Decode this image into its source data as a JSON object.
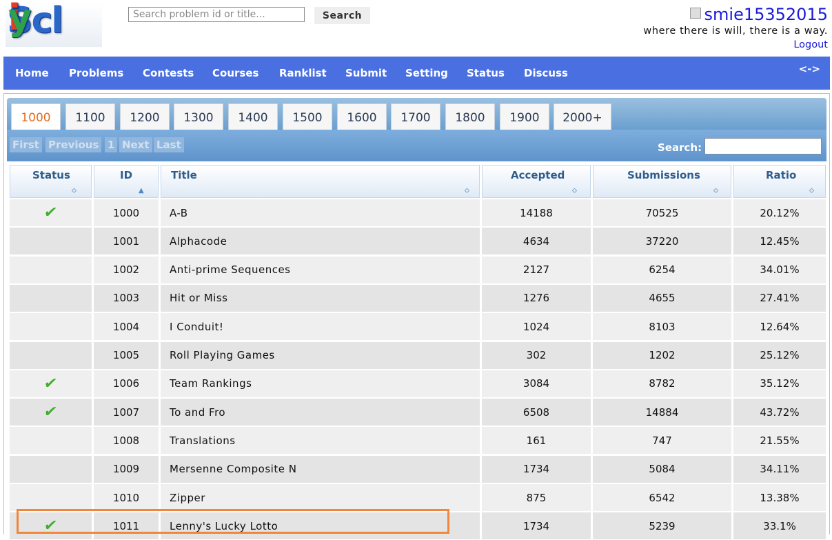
{
  "header": {
    "logo_text": "Sicily",
    "search": {
      "placeholder": "Search problem id or title...",
      "value": "",
      "button_label": "Search"
    },
    "user": {
      "name": "smie15352015",
      "motto": "where there is will,  there is a way.",
      "logout_label": "Logout"
    }
  },
  "navbar": {
    "items": [
      "Home",
      "Problems",
      "Contests",
      "Courses",
      "Ranklist",
      "Submit",
      "Setting",
      "Status",
      "Discuss"
    ],
    "toggle_label": "<->"
  },
  "volume_tabs": {
    "items": [
      "1000",
      "1100",
      "1200",
      "1300",
      "1400",
      "1500",
      "1600",
      "1700",
      "1800",
      "1900",
      "2000+"
    ],
    "active": "1000"
  },
  "pager": {
    "first": "First",
    "previous": "Previous",
    "page": "1",
    "next": "Next",
    "last": "Last",
    "search_label": "Search:",
    "search_value": ""
  },
  "table": {
    "columns": [
      "Status",
      "ID",
      "Title",
      "Accepted",
      "Submissions",
      "Ratio"
    ],
    "sort_column": "ID",
    "rows": [
      {
        "solved": true,
        "status": "✔",
        "id": "1000",
        "title": "A-B",
        "accepted": "14188",
        "submissions": "70525",
        "ratio": "20.12%"
      },
      {
        "solved": false,
        "status": "",
        "id": "1001",
        "title": "Alphacode",
        "accepted": "4634",
        "submissions": "37220",
        "ratio": "12.45%"
      },
      {
        "solved": false,
        "status": "",
        "id": "1002",
        "title": "Anti-prime Sequences",
        "accepted": "2127",
        "submissions": "6254",
        "ratio": "34.01%"
      },
      {
        "solved": false,
        "status": "",
        "id": "1003",
        "title": "Hit or Miss",
        "accepted": "1276",
        "submissions": "4655",
        "ratio": "27.41%"
      },
      {
        "solved": false,
        "status": "",
        "id": "1004",
        "title": "I Conduit!",
        "accepted": "1024",
        "submissions": "8103",
        "ratio": "12.64%"
      },
      {
        "solved": false,
        "status": "",
        "id": "1005",
        "title": "Roll Playing Games",
        "accepted": "302",
        "submissions": "1202",
        "ratio": "25.12%"
      },
      {
        "solved": true,
        "status": "✔",
        "id": "1006",
        "title": "Team Rankings",
        "accepted": "3084",
        "submissions": "8782",
        "ratio": "35.12%"
      },
      {
        "solved": true,
        "status": "✔",
        "id": "1007",
        "title": "To and Fro",
        "accepted": "6508",
        "submissions": "14884",
        "ratio": "43.72%"
      },
      {
        "solved": false,
        "status": "",
        "id": "1008",
        "title": "Translations",
        "accepted": "161",
        "submissions": "747",
        "ratio": "21.55%"
      },
      {
        "solved": false,
        "status": "",
        "id": "1009",
        "title": "Mersenne Composite N",
        "accepted": "1734",
        "submissions": "5084",
        "ratio": "34.11%"
      },
      {
        "solved": false,
        "status": "",
        "id": "1010",
        "title": "Zipper",
        "accepted": "875",
        "submissions": "6542",
        "ratio": "13.38%"
      },
      {
        "solved": true,
        "status": "✔",
        "id": "1011",
        "title": "Lenny's Lucky Lotto",
        "accepted": "1734",
        "submissions": "5239",
        "ratio": "33.1%"
      }
    ],
    "highlighted_row": "1011"
  },
  "colors": {
    "navbar": "#4a6fe0",
    "active_tab_text": "#e46b1b",
    "check": "#3fae2a",
    "highlight": "#f0873a",
    "link": "#1a1adb"
  }
}
